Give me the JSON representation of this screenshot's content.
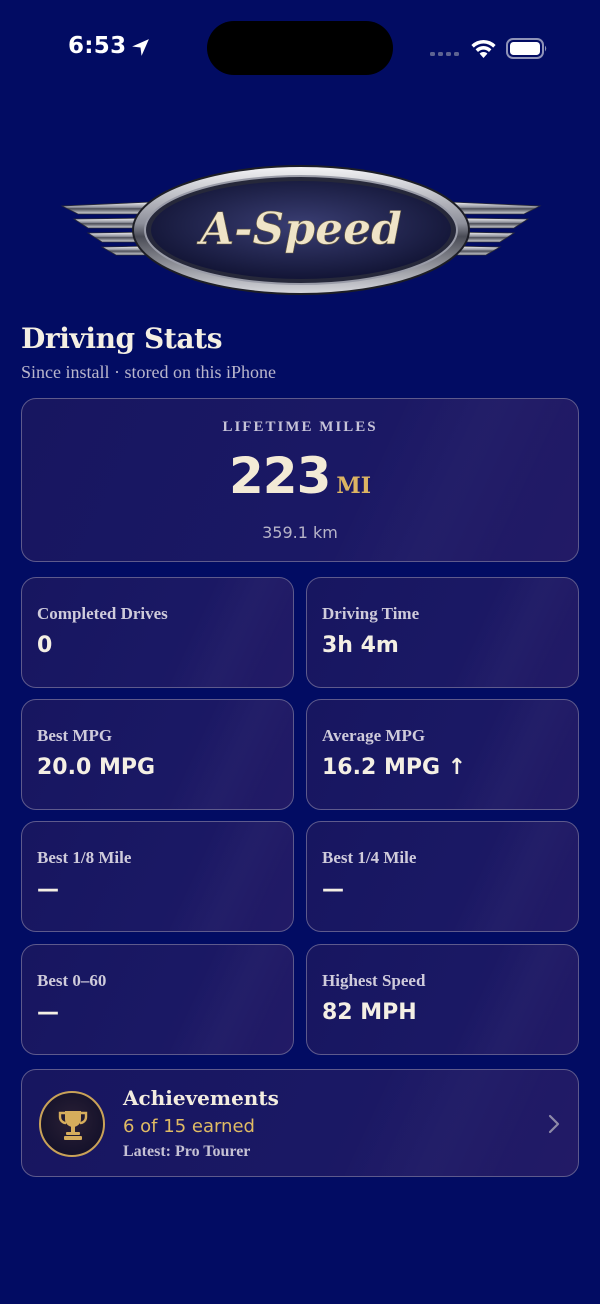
{
  "status_bar": {
    "time": "6:53",
    "icons": [
      "location-arrow-icon",
      "cellular-signal-icon",
      "wifi-icon",
      "battery-icon"
    ]
  },
  "logo": {
    "text": "A-Speed"
  },
  "header": {
    "title": "Driving Stats",
    "subtitle": "Since install · stored on this iPhone"
  },
  "lifetime": {
    "label": "LIFETIME MILES",
    "value": "223",
    "unit": "MI",
    "secondary": "359.1 km"
  },
  "stats": [
    {
      "label": "Completed Drives",
      "value": "0"
    },
    {
      "label": "Driving Time",
      "value": "3h 4m"
    },
    {
      "label": "Best MPG",
      "value": "20.0 MPG"
    },
    {
      "label": "Average MPG",
      "value": "16.2 MPG ↑"
    },
    {
      "label": "Best 1/8 Mile",
      "value": "—"
    },
    {
      "label": "Best 1/4 Mile",
      "value": "—"
    },
    {
      "label": "Best 0–60",
      "value": "—"
    },
    {
      "label": "Highest Speed",
      "value": "82 MPH"
    }
  ],
  "achievements": {
    "title": "Achievements",
    "count": "6 of 15 earned",
    "latest": "Latest: Pro Tourer",
    "icon": "trophy-icon"
  },
  "colors": {
    "background": "#020c63",
    "accent_gold": "#dcb463",
    "card_border": "#5e5a8c"
  }
}
